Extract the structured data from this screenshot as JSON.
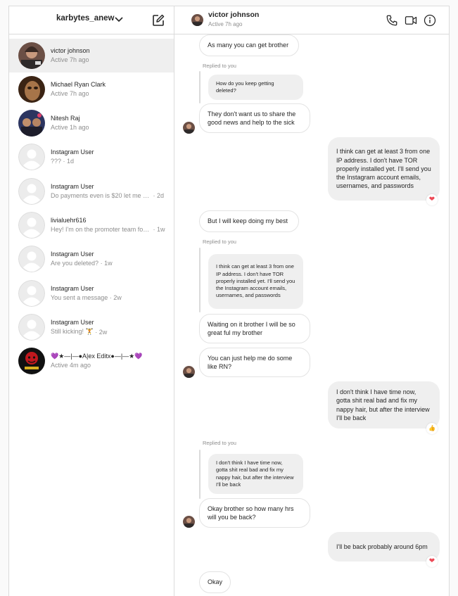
{
  "account": {
    "username": "karbytes_anew"
  },
  "conversations": [
    {
      "name": "victor johnson",
      "status": "Active 7h ago",
      "active": true
    },
    {
      "name": "Michael Ryan Clark",
      "status": "Active 7h ago"
    },
    {
      "name": "Nitesh Raj",
      "status": "Active 1h ago"
    },
    {
      "name": "Instagram User",
      "preview": "???",
      "time": "· 1d"
    },
    {
      "name": "Instagram User",
      "preview": "Do payments even is $20 let me know.",
      "time": "· 2d"
    },
    {
      "name": "livialuehr616",
      "preview": "Hey! I'm on the promoter team for this page",
      "time": "· 1w"
    },
    {
      "name": "Instagram User",
      "preview": "Are you deleted?",
      "time": "· 1w"
    },
    {
      "name": "Instagram User",
      "preview": "You sent a message",
      "time": "· 2w"
    },
    {
      "name": "Instagram User",
      "preview": "Still kicking! 🏋",
      "time": "· 2w"
    },
    {
      "name": "💜★—|—●A|ex Editx●—|—★💜",
      "status": "Active 4m ago"
    }
  ],
  "chat": {
    "name": "victor johnson",
    "status": "Active 7h ago",
    "reply_label": "Replied to you",
    "messages": {
      "m1": "As many you can get brother",
      "r1": "How do you keep getting deleted?",
      "m2": "They don't want us to share the good news and help to the sick",
      "m3": "I think can get at least 3 from one IP address. I don't have TOR properly installed yet. I'll send you the Instagram account emails, usernames, and passwords",
      "m4": "But I will keep doing my best",
      "r2": "I think can get at least 3 from one IP address. I don't have TOR properly installed yet. I'll send you the Instagram account emails, usernames, and passwords",
      "m5": "Waiting on it brother I will be so great ful my brother",
      "m6": "You can just help me do some like RN?",
      "m7": "I don't think I have time now, gotta shit real bad and fix my nappy hair, but after the interview I'll be back",
      "r3": "I don't think I have time now, gotta shit real bad and fix my nappy hair, but after the interview I'll be back",
      "m8": "Okay brother so how many hrs will you be back?",
      "m9": "I'll be back probably around 6pm",
      "m10": "Okay"
    },
    "reactions": {
      "heart": "❤",
      "thumbs": "👍"
    }
  },
  "colors": {
    "heart": "#ed4956",
    "border": "#dbdbdb",
    "muted": "#8e8e8e"
  }
}
